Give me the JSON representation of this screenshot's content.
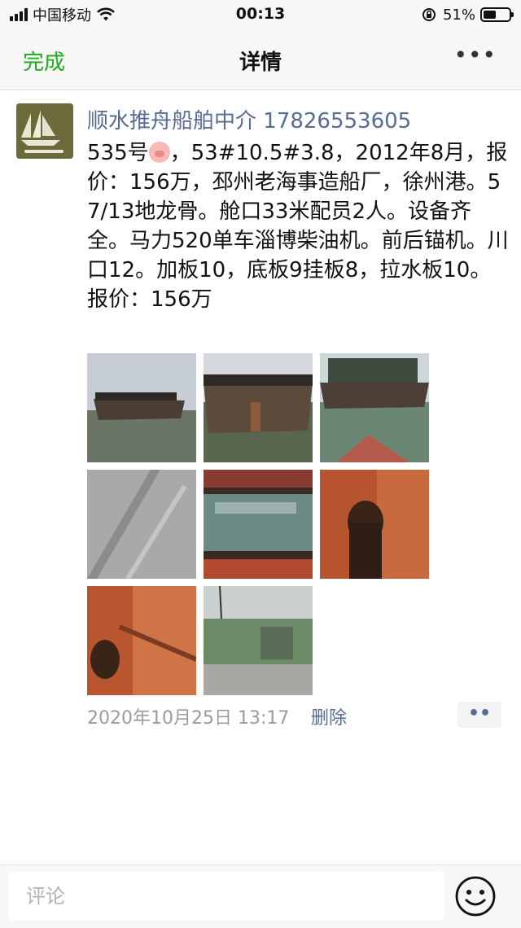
{
  "status_bar": {
    "carrier": "中国移动",
    "time": "00:13",
    "battery": "51%",
    "battery_level": 0.51,
    "signal_bars": 4
  },
  "nav": {
    "done": "完成",
    "title": "详情",
    "more": "•••"
  },
  "post": {
    "author": "顺水推舟船舶中介 17826553605",
    "text_before_emoji": "535号",
    "emoji": "pig-face-emoji",
    "text_after_emoji": "，53#10.5#3.8，2012年8月，报价：156万，邳州老海事造船厂，徐州港。57/13地龙骨。舱口33米配员2人。设备齐全。马力520单车淄博柴油机。前后锚机。川口12。加板10，底板9挂板8，拉水板10。\n报价：156万",
    "timestamp": "2020年10月25日 13:17",
    "delete_label": "删除",
    "action_label": "••",
    "photo_count": 8
  },
  "comment": {
    "placeholder": "评论",
    "emoji_icon": "smiley-icon"
  },
  "colors": {
    "accent_green": "#1aad19",
    "link_blue": "#576b95",
    "muted_gray": "#9b9b9b"
  }
}
